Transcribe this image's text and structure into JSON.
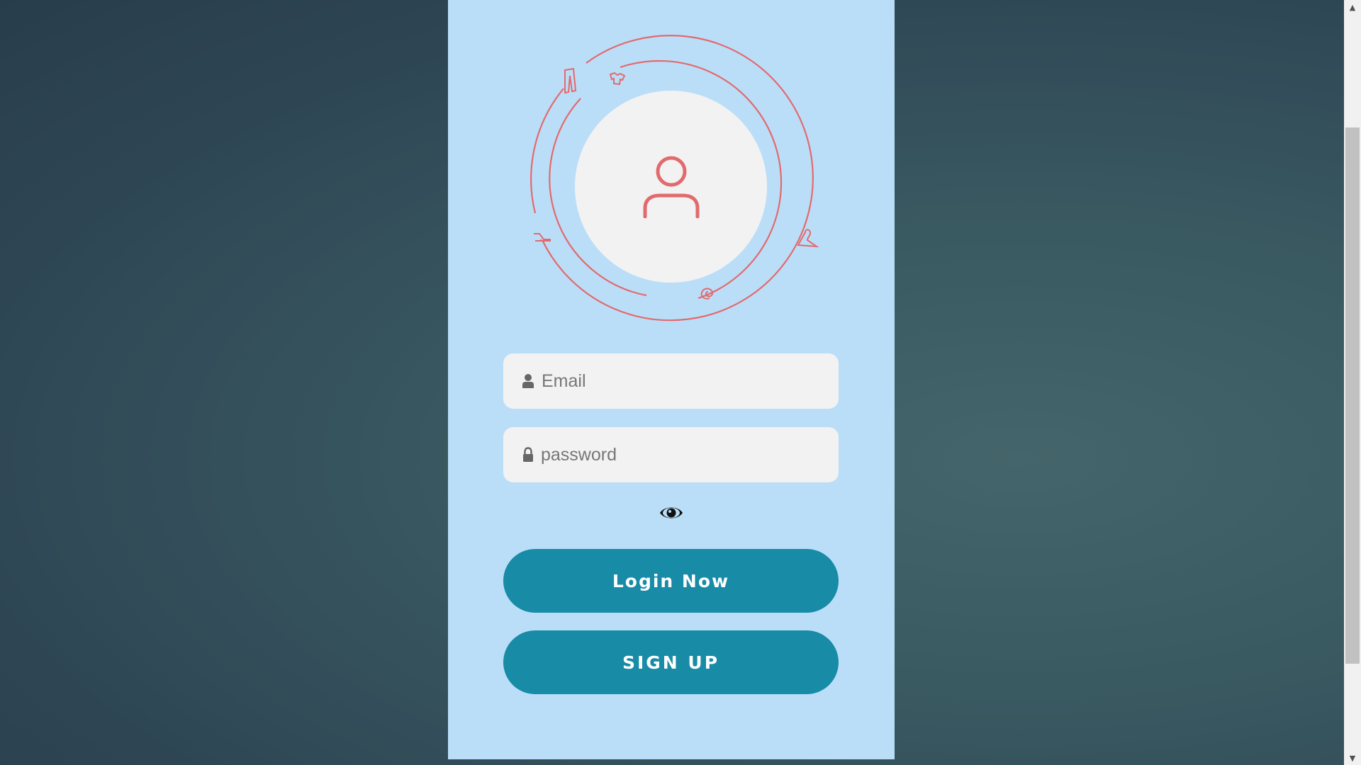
{
  "login_form": {
    "email_placeholder": "Email",
    "password_placeholder": "password",
    "login_label": "Login Now",
    "signup_label": "SIGN UP"
  },
  "icons": {
    "avatar": "user-icon",
    "email_field": "user-icon",
    "password_field": "lock-icon",
    "password_toggle": "eye-icon",
    "orbit": [
      "pants-icon",
      "shirt-icon",
      "hanger-icon",
      "spiral-icon",
      "iron-icon"
    ]
  },
  "colors": {
    "card_background": "#bbdef8",
    "accent_red": "#e26a6e",
    "button": "#188ba6",
    "field_background": "#f2f2f2"
  }
}
